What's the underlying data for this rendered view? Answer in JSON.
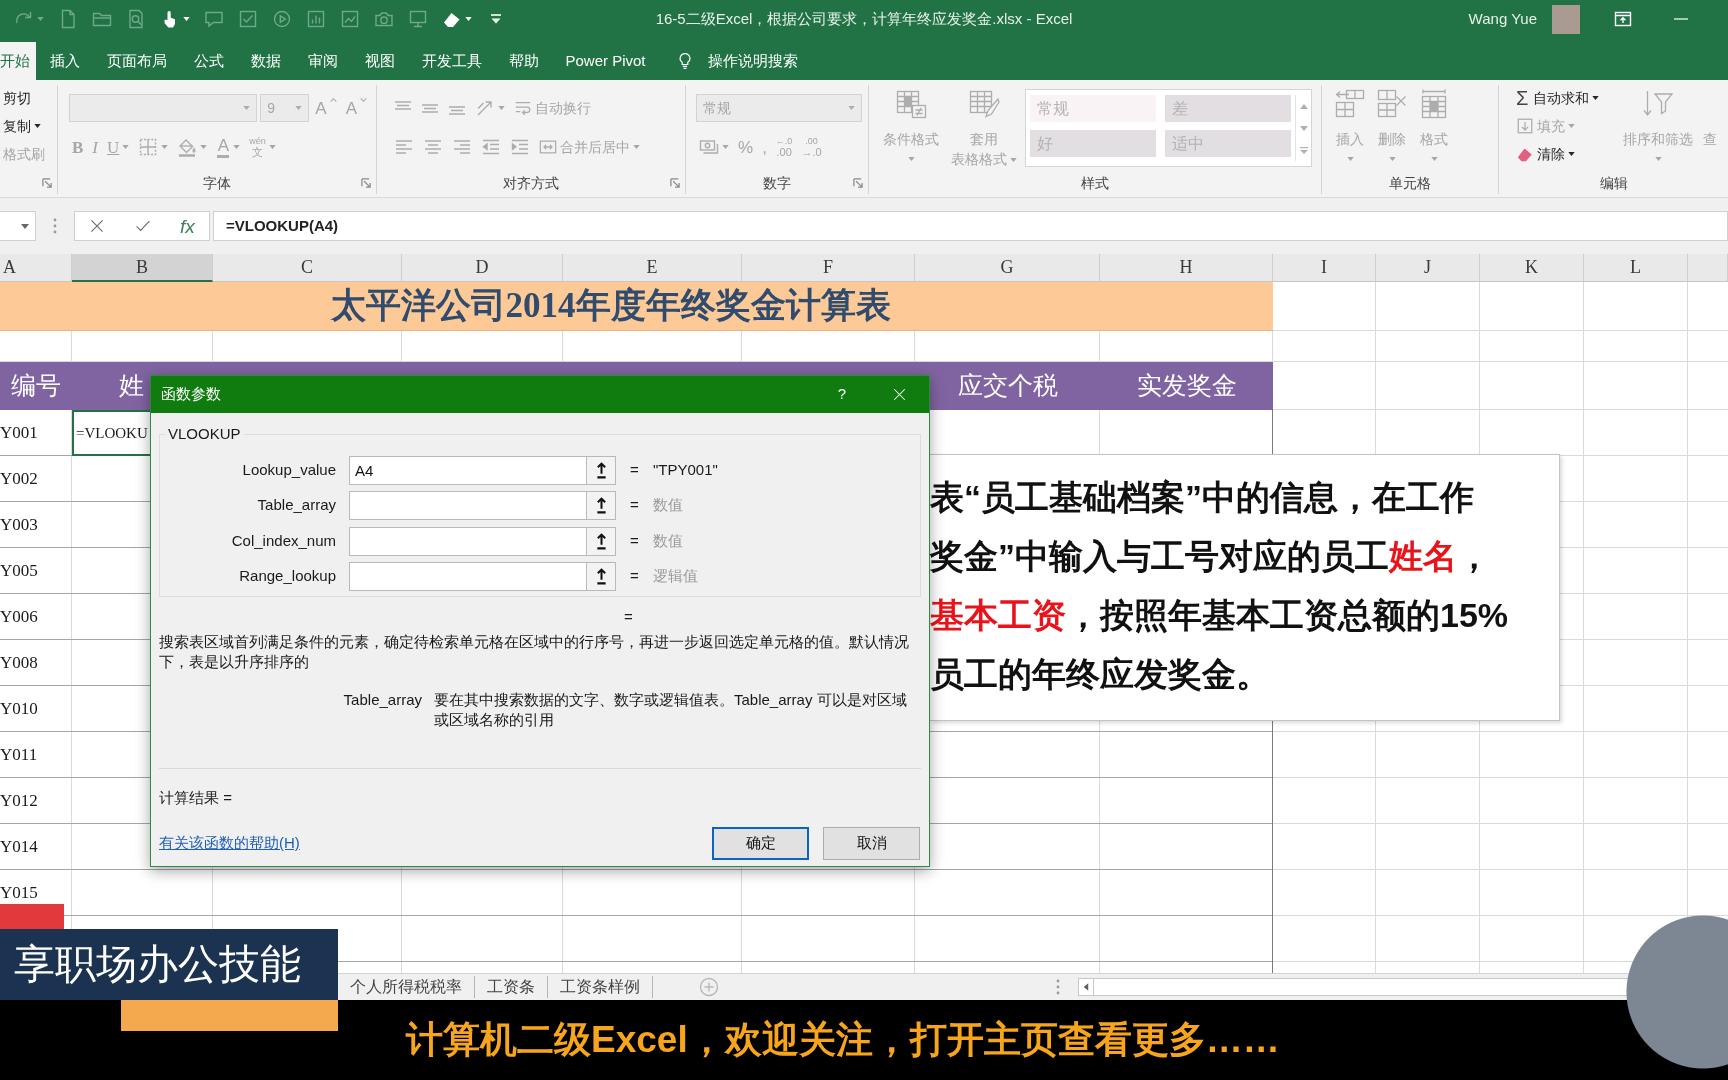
{
  "title_bar": {
    "quick_access": [
      {
        "disabled": true,
        "menu": true
      },
      {
        "disabled": true
      },
      {
        "disabled": true
      },
      {
        "disabled": true
      },
      {
        "disabled": false,
        "menu": true
      },
      {
        "disabled": true
      },
      {
        "disabled": true
      },
      {
        "disabled": true
      },
      {
        "disabled": true
      },
      {
        "disabled": true
      },
      {
        "disabled": true
      },
      {
        "disabled": true
      },
      {
        "disabled": false,
        "menu": true
      },
      {
        "disabled": false
      }
    ],
    "title": "16-5二级Excel，根据公司要求，计算年终应发奖金.xlsx - Excel",
    "user": "Wang Yue"
  },
  "tabs": [
    {
      "label": "开始",
      "selected": true
    },
    {
      "label": "插入",
      "selected": false
    },
    {
      "label": "页面布局",
      "selected": false
    },
    {
      "label": "公式",
      "selected": false
    },
    {
      "label": "数据",
      "selected": false
    },
    {
      "label": "审阅",
      "selected": false
    },
    {
      "label": "视图",
      "selected": false
    },
    {
      "label": "开发工具",
      "selected": false
    },
    {
      "label": "帮助",
      "selected": false
    },
    {
      "label": "Power Pivot",
      "selected": false
    }
  ],
  "tell_me": "操作说明搜索",
  "ribbon": {
    "groups": [
      {
        "launcher": true,
        "columns": [
          {
            "kind": "stack",
            "rows": [
              [
                {
                  "kind": "text",
                  "label": "剪切",
                  "disabled": false
                }
              ],
              [
                {
                  "kind": "text",
                  "label": "复制",
                  "disabled": false,
                  "menu": true
                }
              ],
              [
                {
                  "kind": "text",
                  "label": "格式刷",
                  "disabled": true
                }
              ]
            ]
          }
        ]
      },
      {
        "label": "字体",
        "launcher": true,
        "columns": [
          {
            "kind": "stack",
            "rows": [
              [
                {
                  "kind": "combo",
                  "disabled": true
                },
                {
                  "kind": "small-combo",
                  "value": "9",
                  "disabled": true
                },
                {
                  "kind": "glyph",
                  "label": "A",
                  "disabled": true
                },
                {
                  "kind": "glyph",
                  "label": "A",
                  "disabled": true
                }
              ],
              [
                {
                  "kind": "glyph",
                  "label": "B",
                  "disabled": true
                },
                {
                  "kind": "glyph",
                  "label": "I",
                  "disabled": true
                },
                {
                  "kind": "glyph",
                  "label": "U",
                  "disabled": true,
                  "menu": true
                },
                {
                  "kind": "icon",
                  "disabled": true,
                  "menu": true
                },
                {
                  "kind": "icon",
                  "disabled": true,
                  "menu": true
                },
                {
                  "kind": "glyph",
                  "label": "A",
                  "disabled": true,
                  "menu": true
                },
                {
                  "kind": "glyph",
                  "label": "文",
                  "top_line": "wén",
                  "disabled": true,
                  "menu": true
                }
              ]
            ]
          }
        ]
      },
      {
        "label": "对齐方式",
        "launcher": true,
        "columns": [
          {
            "kind": "stack",
            "rows": [
              [
                {
                  "kind": "icon",
                  "disabled": true
                },
                {
                  "kind": "icon",
                  "disabled": true
                },
                {
                  "kind": "icon",
                  "disabled": true
                },
                {
                  "kind": "icon",
                  "disabled": true,
                  "menu": true
                },
                {
                  "kind": "small",
                  "label": "自动换行",
                  "disabled": true
                }
              ],
              [
                {
                  "kind": "icon",
                  "disabled": true
                },
                {
                  "kind": "icon",
                  "disabled": true
                },
                {
                  "kind": "icon",
                  "disabled": true
                },
                {
                  "kind": "icon",
                  "disabled": true
                },
                {
                  "kind": "icon",
                  "disabled": true
                },
                {
                  "kind": "small",
                  "label": "合并后居中",
                  "disabled": true,
                  "menu": true
                }
              ]
            ]
          }
        ]
      },
      {
        "label": "数字",
        "launcher": true,
        "columns": [
          {
            "kind": "stack",
            "rows": [
              [
                {
                  "kind": "combo",
                  "value": "常规",
                  "disabled": true
                }
              ],
              [
                {
                  "kind": "icon",
                  "disabled": true,
                  "menu": true
                },
                {
                  "kind": "glyph",
                  "label": "%",
                  "disabled": true
                },
                {
                  "kind": "glyph",
                  "label": ",",
                  "disabled": true
                },
                {
                  "kind": "glyph",
                  "label": ".00",
                  "top_line": "←.0",
                  "disabled": true
                },
                {
                  "kind": "glyph",
                  "label": "→.0",
                  "top_line": ".00",
                  "disabled": true
                }
              ]
            ]
          }
        ]
      },
      {
        "label": "样式",
        "columns": [
          {
            "kind": "large",
            "label_lines": [
              "条件格式"
            ],
            "disabled": true,
            "menu": true
          },
          {
            "kind": "large",
            "label_lines": [
              "套用",
              "表格格式"
            ],
            "disabled": true,
            "menu": true
          },
          {
            "kind": "gallery",
            "disabled": true,
            "styles": [
              {
                "label": "常规",
                "color": "#faf3f6"
              },
              {
                "label": "差",
                "color": "#e3dee1"
              },
              {
                "label": "好",
                "color": "#e3dee1"
              },
              {
                "label": "适中",
                "color": "#e3dee1"
              }
            ]
          }
        ]
      },
      {
        "label": "单元格",
        "columns": [
          {
            "kind": "large",
            "label_lines": [
              "插入"
            ],
            "disabled": true,
            "menu": true
          },
          {
            "kind": "large",
            "label_lines": [
              "删除"
            ],
            "disabled": true,
            "menu": true
          },
          {
            "kind": "large",
            "label_lines": [
              "格式"
            ],
            "disabled": true,
            "menu": true
          }
        ]
      },
      {
        "label": "编辑",
        "columns": [
          {
            "kind": "stack",
            "rows": [
              [
                {
                  "kind": "small",
                  "glyph": "Σ",
                  "label": "自动求和",
                  "disabled": false,
                  "menu": true
                }
              ],
              [
                {
                  "kind": "small",
                  "label": "填充",
                  "disabled": true,
                  "menu": true
                }
              ],
              [
                {
                  "kind": "small",
                  "label": "清除",
                  "disabled": false,
                  "menu": true
                }
              ]
            ]
          },
          {
            "kind": "large",
            "label_lines": [
              "排序和筛选"
            ],
            "disabled": true,
            "menu": true
          },
          {
            "kind": "large",
            "label_lines": [
              "查"
            ],
            "disabled": true
          }
        ]
      }
    ]
  },
  "formula_bar": {
    "function_label": "fx",
    "formula": "=VLOOKUP(A4)"
  },
  "sheet": {
    "columns": [
      {
        "label": "A",
        "selected": false
      },
      {
        "label": "B",
        "selected": true
      },
      {
        "label": "C",
        "selected": false
      },
      {
        "label": "D",
        "selected": false
      },
      {
        "label": "E",
        "selected": false
      },
      {
        "label": "F",
        "selected": false
      },
      {
        "label": "G",
        "selected": false
      },
      {
        "label": "H",
        "selected": false
      },
      {
        "label": "I",
        "selected": false
      },
      {
        "label": "J",
        "selected": false
      },
      {
        "label": "K",
        "selected": false
      },
      {
        "label": "L",
        "selected": false
      }
    ],
    "title": "太平洋公司2014年度年终奖金计算表",
    "header_left": [
      "编号",
      "姓"
    ],
    "header_right": [
      "应交个税",
      "实发奖金"
    ],
    "rows": [
      [
        {
          "text": "Y001",
          "selected": false
        },
        {
          "text": "=VLOOKU",
          "selected": true
        }
      ],
      [
        {
          "text": "Y002",
          "selected": false
        }
      ],
      [
        {
          "text": "Y003",
          "selected": false
        }
      ],
      [
        {
          "text": "Y005",
          "selected": false
        }
      ],
      [
        {
          "text": "Y006",
          "selected": false
        }
      ],
      [
        {
          "text": "Y008",
          "selected": false
        }
      ],
      [
        {
          "text": "Y010",
          "selected": false
        }
      ],
      [
        {
          "text": "Y011",
          "selected": false
        }
      ],
      [
        {
          "text": "Y012",
          "selected": false
        }
      ],
      [
        {
          "text": "Y014",
          "selected": false
        }
      ],
      [
        {
          "text": "Y015",
          "selected": false
        }
      ]
    ]
  },
  "dialog": {
    "title": "函数参数",
    "help": "?",
    "function": "VLOOKUP",
    "arguments": [
      {
        "name": "Lookup_value",
        "value": "A4",
        "equals": "=",
        "result": "\"TPY001\"",
        "muted": false
      },
      {
        "name": "Table_array",
        "equals": "=",
        "result": "数值",
        "muted": true
      },
      {
        "name": "Col_index_num",
        "equals": "=",
        "result": "数值",
        "muted": true
      },
      {
        "name": "Range_lookup",
        "equals": "=",
        "result": "逻辑值",
        "muted": true
      }
    ],
    "result_equals": "=",
    "description": "搜索表区域首列满足条件的元素，确定待检索单元格在区域中的行序号，再进一步返回选定单元格的值。默认情况下，表是以升序排序的",
    "argument_help": {
      "name": "Table_array",
      "text": "要在其中搜索数据的文字、数字或逻辑值表。Table_array 可以是对区域或区域名称的引用"
    },
    "formula_result": "计算结果 =",
    "help_link": "有关该函数的帮助(H)",
    "buttons": [
      {
        "label": "确定",
        "default": true
      },
      {
        "label": "取消",
        "default": false
      }
    ]
  },
  "note": {
    "lines": [
      [
        {
          "text": "表“员工基础档案”中的信息，在工作",
          "highlight": false
        }
      ],
      [
        {
          "text": "奖金”中输入与工号对应的员工",
          "highlight": false
        },
        {
          "text": "姓名",
          "highlight": true
        },
        {
          "text": "，",
          "highlight": false
        }
      ],
      [
        {
          "text": "基本工资",
          "highlight": true
        },
        {
          "text": "，按照年基本工资总额的15%",
          "highlight": false
        }
      ],
      [
        {
          "text": "员工的年终应发奖金。",
          "highlight": false
        }
      ]
    ]
  },
  "sheet_tabs": [
    {
      "label": "个人所得税税率",
      "selected": false
    },
    {
      "label": "工资条",
      "selected": false
    },
    {
      "label": "工资条样例",
      "selected": false
    }
  ],
  "banner": "享职场办公技能",
  "caption": "计算机二级Excel，欢迎关注，打开主页查看更多……"
}
